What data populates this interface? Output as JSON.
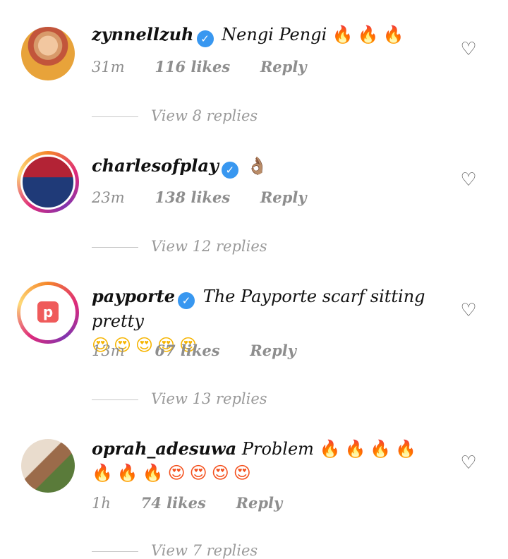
{
  "comments": [
    {
      "username": "zynnellzuh",
      "verified": true,
      "text": "Nengi Pengi",
      "emojis": "🔥🔥🔥",
      "time": "31m",
      "likes": "116 likes",
      "reply_label": "Reply",
      "view_replies": "View 8 replies",
      "avatar_style": "plain"
    },
    {
      "username": "charlesofplay",
      "verified": true,
      "text": "",
      "emojis": "👌🏽",
      "time": "23m",
      "likes": "138 likes",
      "reply_label": "Reply",
      "view_replies": "View 12 replies",
      "avatar_style": "story-ring"
    },
    {
      "username": "payporte",
      "verified": true,
      "text": "The Payporte scarf sitting pretty",
      "emojis": "😍😍😍😍😍",
      "time": "13m",
      "likes": "67 likes",
      "reply_label": "Reply",
      "view_replies": "View 13 replies",
      "avatar_style": "story-ring"
    },
    {
      "username": "oprah_adesuwa",
      "verified": false,
      "text": "Problem",
      "emojis": "🔥🔥🔥🔥🔥🔥🔥😍😍😍😍",
      "time": "1h",
      "likes": "74 likes",
      "reply_label": "Reply",
      "view_replies": "View 7 replies",
      "avatar_style": "plain"
    }
  ],
  "icons": {
    "like": "heart-outline-icon",
    "verified": "verified-badge-icon"
  },
  "colors": {
    "verified_blue": "#3897f0",
    "meta_gray": "#8e8e8e"
  }
}
